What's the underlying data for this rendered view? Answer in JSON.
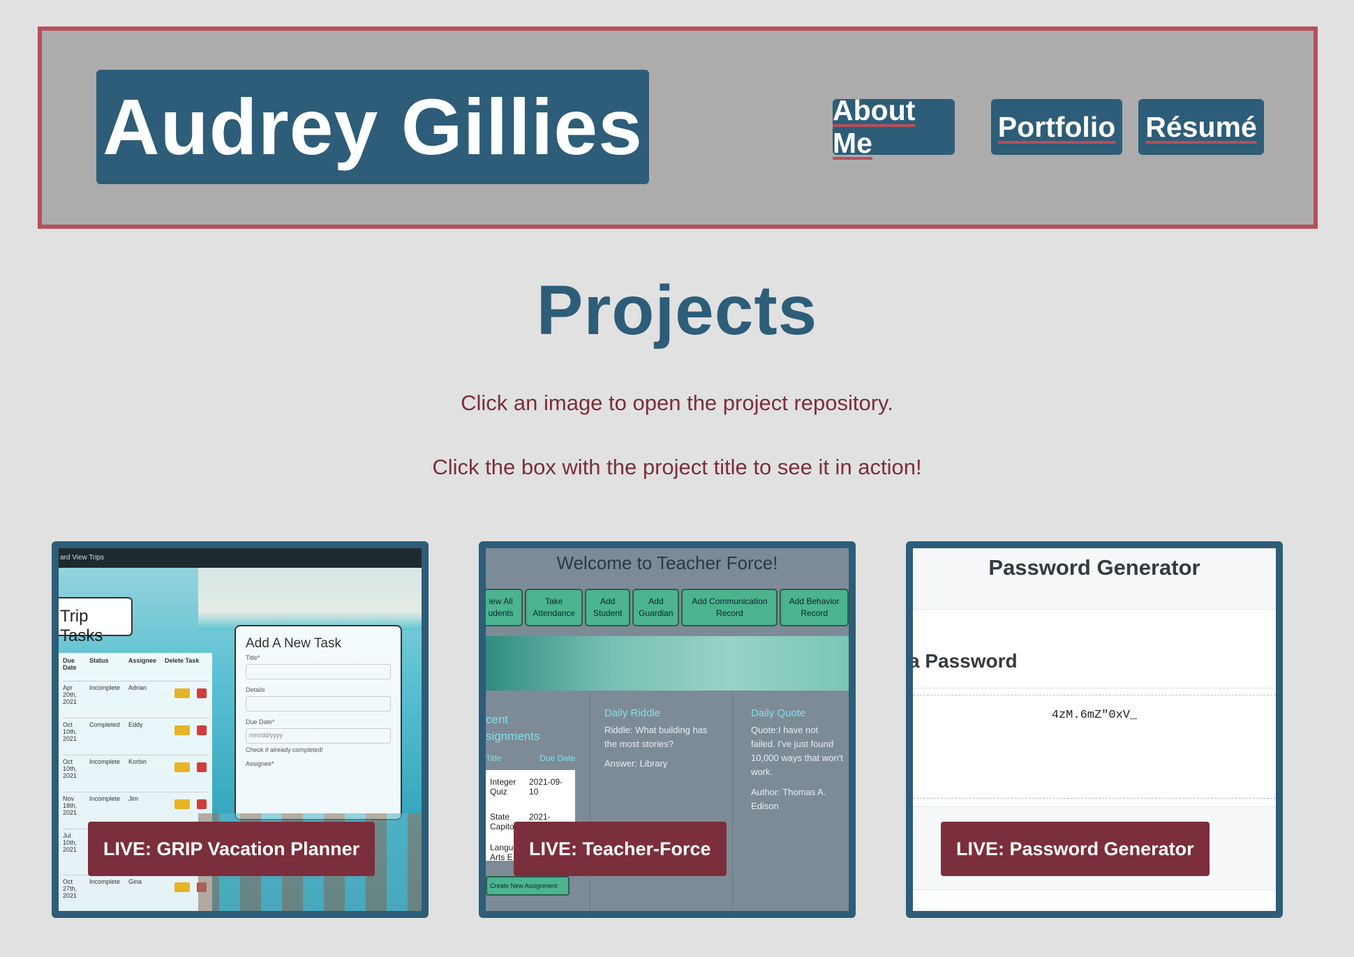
{
  "header": {
    "name": "Audrey Gillies",
    "nav": [
      {
        "label": "About Me"
      },
      {
        "label": "Portfolio"
      },
      {
        "label": "Résumé"
      }
    ]
  },
  "main": {
    "title": "Projects",
    "instruction_1": "Click an image to open the project repository.",
    "instruction_2": "Click the box with the project title to see it in action!"
  },
  "projects": [
    {
      "live_label": "LIVE: GRIP Vacation Planner",
      "thumb": {
        "topbar": "ard   View Trips",
        "tab": "Trip Tasks",
        "form_title": "Add A New Task",
        "table_headers": [
          "Due Date",
          "Status",
          "Assignee",
          "Delete Task"
        ],
        "rows": [
          {
            "date": "Apr 20th, 2021",
            "status": "Incomplete",
            "assignee": "Adrian"
          },
          {
            "date": "Oct 10th, 2021",
            "status": "Completed",
            "assignee": "Eddy"
          },
          {
            "date": "Oct 10th, 2021",
            "status": "Incomplete",
            "assignee": "Korbin"
          },
          {
            "date": "Nov 18th, 2021",
            "status": "Incomplete",
            "assignee": "Jim"
          },
          {
            "date": "Jul 10th, 2021",
            "status": "",
            "assignee": ""
          },
          {
            "date": "Oct 27th, 2021",
            "status": "Incomplete",
            "assignee": "Gina"
          }
        ],
        "form_labels": [
          "Title*",
          "Details",
          "Due Date*",
          "Assignee*"
        ],
        "date_placeholder": "mm/dd/yyyy",
        "check_label": "Check if already completed!",
        "edit": "Edit",
        "del": "X"
      }
    },
    {
      "live_label": "LIVE: Teacher-Force",
      "thumb": {
        "heading": "Welcome to Teacher Force!",
        "buttons": [
          "iew All udents",
          "Take Attendance",
          "Add Student",
          "Add Guardian",
          "Add Communication Record",
          "Add Behavior Record"
        ],
        "col1_title": "cent signments",
        "col1_headers": [
          "Title",
          "Due Date"
        ],
        "col1_rows": [
          {
            "title": "Integer Quiz",
            "due": "2021-09-10"
          },
          {
            "title": "State Capito",
            "due": "2021-"
          },
          {
            "title": "Langu Arts E",
            "due": ""
          }
        ],
        "create": "Create New Assignment",
        "riddle_title": "Daily Riddle",
        "riddle_text": "Riddle: What building has the most stories?",
        "riddle_answer": "Answer: Library",
        "quote_title": "Daily Quote",
        "quote_text": "Quote:I have not failed. I've just found 10,000 ways that won't work.",
        "quote_author": "Author: Thomas A. Edison"
      }
    },
    {
      "live_label": "LIVE: Password Generator",
      "thumb": {
        "heading": "Password Generator",
        "subheading": "a Password",
        "password": "4zM.6mZ\"0xV_"
      }
    }
  ],
  "colors": {
    "background": "#e1e1e1",
    "header_bg": "#acacac",
    "header_border": "#b5505b",
    "primary": "#2d5d78",
    "accent": "#7b2e3c"
  }
}
